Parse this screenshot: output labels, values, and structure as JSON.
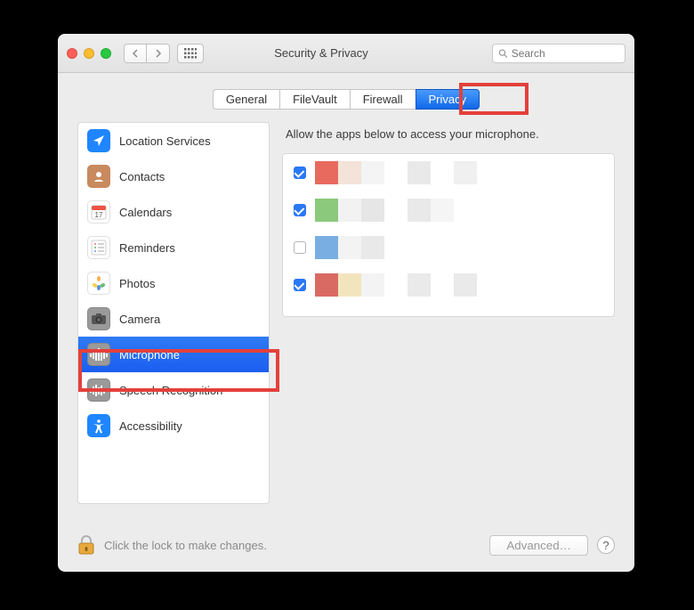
{
  "window": {
    "title": "Security & Privacy"
  },
  "search": {
    "placeholder": "Search"
  },
  "tabs": [
    {
      "id": "general",
      "label": "General",
      "active": false
    },
    {
      "id": "filevault",
      "label": "FileVault",
      "active": false
    },
    {
      "id": "firewall",
      "label": "Firewall",
      "active": false
    },
    {
      "id": "privacy",
      "label": "Privacy",
      "active": true
    }
  ],
  "sidebar": {
    "items": [
      {
        "id": "location",
        "label": "Location Services",
        "icon": "location-icon",
        "icon_bg": "#1f86ff",
        "selected": false
      },
      {
        "id": "contacts",
        "label": "Contacts",
        "icon": "contacts-icon",
        "icon_bg": "#c88a5e",
        "selected": false
      },
      {
        "id": "calendars",
        "label": "Calendars",
        "icon": "calendar-icon",
        "icon_bg": "#ffffff",
        "selected": false
      },
      {
        "id": "reminders",
        "label": "Reminders",
        "icon": "reminders-icon",
        "icon_bg": "#ffffff",
        "selected": false
      },
      {
        "id": "photos",
        "label": "Photos",
        "icon": "photos-icon",
        "icon_bg": "#ffffff",
        "selected": false
      },
      {
        "id": "camera",
        "label": "Camera",
        "icon": "camera-icon",
        "icon_bg": "#9a9a9a",
        "selected": false
      },
      {
        "id": "microphone",
        "label": "Microphone",
        "icon": "microphone-icon",
        "icon_bg": "#9a9a9a",
        "selected": true
      },
      {
        "id": "speech",
        "label": "Speech Recognition",
        "icon": "speech-icon",
        "icon_bg": "#9a9a9a",
        "selected": false
      },
      {
        "id": "accessibility",
        "label": "Accessibility",
        "icon": "accessibility-icon",
        "icon_bg": "#1f86ff",
        "selected": false
      }
    ]
  },
  "main": {
    "heading": "Allow the apps below to access your microphone.",
    "apps": [
      {
        "checked": true,
        "pixel_colors": [
          "#e86a5f",
          "#f3e3d8",
          "#f4f4f4",
          "#ffffff",
          "#e9e9e9",
          "#ffffff",
          "#f0f0f0"
        ]
      },
      {
        "checked": true,
        "pixel_colors": [
          "#8bc97d",
          "#f2f2f2",
          "#e6e6e6",
          "#ffffff",
          "#e9e9e9",
          "#f5f5f5",
          "#ffffff"
        ]
      },
      {
        "checked": false,
        "pixel_colors": [
          "#79aee2",
          "#f3f3f3",
          "#e9e9e9",
          "#ffffff",
          "#ffffff",
          "#ffffff",
          "#ffffff"
        ]
      },
      {
        "checked": true,
        "pixel_colors": [
          "#d96a63",
          "#f2e5bd",
          "#f3f3f3",
          "#ffffff",
          "#eaeaea",
          "#ffffff",
          "#eaeaea"
        ]
      }
    ]
  },
  "footer": {
    "lock_text": "Click the lock to make changes.",
    "advanced_label": "Advanced…",
    "help_label": "?"
  },
  "highlights": [
    {
      "target": "tab-privacy"
    },
    {
      "target": "sidebar-item-microphone"
    }
  ]
}
